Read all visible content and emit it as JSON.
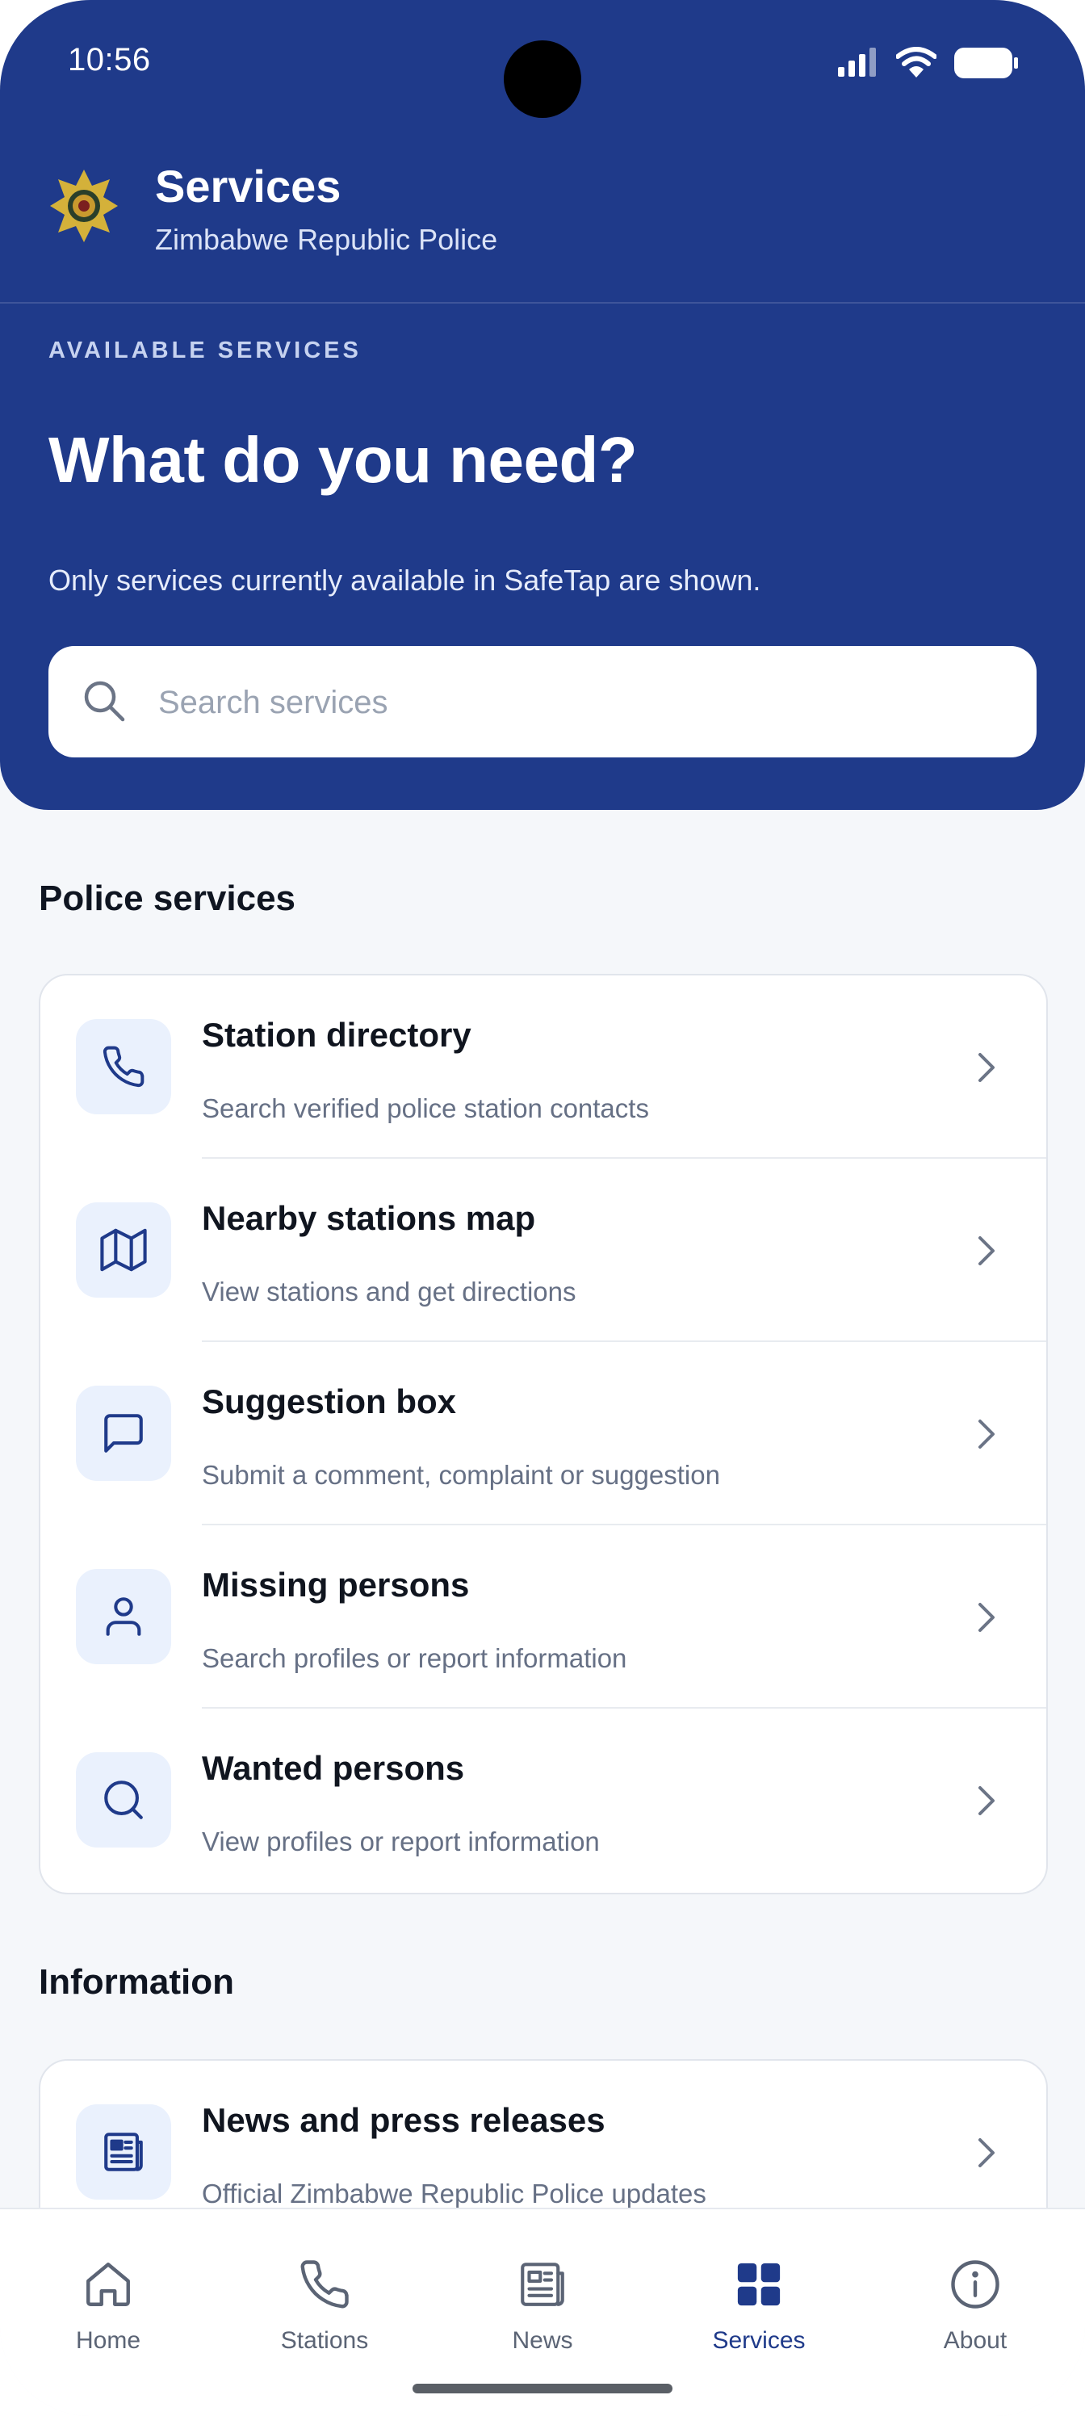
{
  "status_bar": {
    "time": "10:56"
  },
  "app_bar": {
    "title": "Services",
    "subtitle": "Zimbabwe Republic Police"
  },
  "hero": {
    "eyebrow": "AVAILABLE SERVICES",
    "title": "What do you need?",
    "description": "Only services currently available in SafeTap are shown."
  },
  "search": {
    "placeholder": "Search services",
    "value": ""
  },
  "sections": [
    {
      "title": "Police services",
      "items": [
        {
          "title": "Station directory",
          "subtitle": "Search verified police station contacts",
          "icon": "phone-icon"
        },
        {
          "title": "Nearby stations map",
          "subtitle": "View stations and get directions",
          "icon": "map-icon"
        },
        {
          "title": "Suggestion box",
          "subtitle": "Submit a comment, complaint or suggestion",
          "icon": "chat-bubble-icon"
        },
        {
          "title": "Missing persons",
          "subtitle": "Search profiles or report information",
          "icon": "person-icon"
        },
        {
          "title": "Wanted persons",
          "subtitle": "View profiles or report information",
          "icon": "search-icon"
        }
      ]
    },
    {
      "title": "Information",
      "items": [
        {
          "title": "News and press releases",
          "subtitle": "Official Zimbabwe Republic Police updates",
          "icon": "newspaper-icon"
        }
      ]
    }
  ],
  "bottom_nav": {
    "items": [
      {
        "label": "Home",
        "icon": "home-icon",
        "active": false
      },
      {
        "label": "Stations",
        "icon": "phone-icon",
        "active": false
      },
      {
        "label": "News",
        "icon": "newspaper-icon",
        "active": false
      },
      {
        "label": "Services",
        "icon": "grid-icon",
        "active": true
      },
      {
        "label": "About",
        "icon": "info-icon",
        "active": false
      }
    ]
  },
  "colors": {
    "primary": "#1f3a8a",
    "background": "#f5f7fa",
    "icon_tile": "#eaf1fd",
    "text_secondary": "#667085"
  }
}
